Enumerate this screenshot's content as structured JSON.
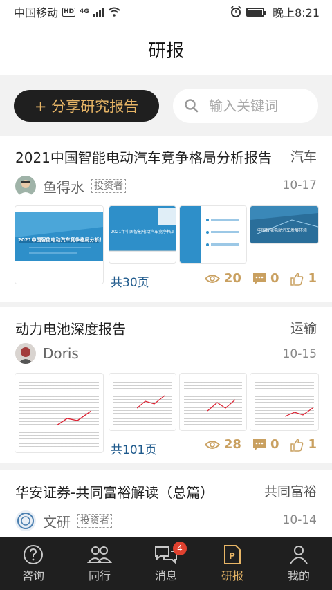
{
  "status_bar": {
    "carrier": "中国移动",
    "hd": "HD",
    "network": "4G",
    "time": "晚上8:21"
  },
  "header": {
    "title": "研报"
  },
  "actions": {
    "share_label": "+ 分享研究报告",
    "search_placeholder": "输入关键词"
  },
  "reports": [
    {
      "title": "2021中国智能电动汽车竞争格局分析报告",
      "tag": "汽车",
      "author": "鱼得水",
      "investor_label": "投资者",
      "date": "10-17",
      "pages": "共30页",
      "views": "20",
      "comments": "0",
      "likes": "1",
      "thumb_texts": [
        "2021中国智能电动汽车竞争格局分析报",
        "2021年中国智能电动汽车竞争格局分析报告",
        "中国智能电动汽车发展环境"
      ]
    },
    {
      "title": "动力电池深度报告",
      "tag": "运输",
      "author": "Doris",
      "date": "10-15",
      "pages": "共101页",
      "views": "28",
      "comments": "0",
      "likes": "1"
    },
    {
      "title": "华安证券-共同富裕解读（总篇）",
      "tag": "共同富裕",
      "author": "文研",
      "investor_label": "投资者",
      "date": "10-14"
    }
  ],
  "tabbar": {
    "items": [
      {
        "label": "咨询",
        "icon": "question-circle-icon"
      },
      {
        "label": "同行",
        "icon": "people-icon"
      },
      {
        "label": "消息",
        "icon": "chat-bubbles-icon",
        "badge": "4"
      },
      {
        "label": "研报",
        "icon": "report-p-icon",
        "active": true
      },
      {
        "label": "我的",
        "icon": "person-icon"
      }
    ]
  },
  "colors": {
    "accent": "#e7b566",
    "dark": "#1f1f1f",
    "link": "#1f5a8c",
    "badge": "#e0412f"
  }
}
